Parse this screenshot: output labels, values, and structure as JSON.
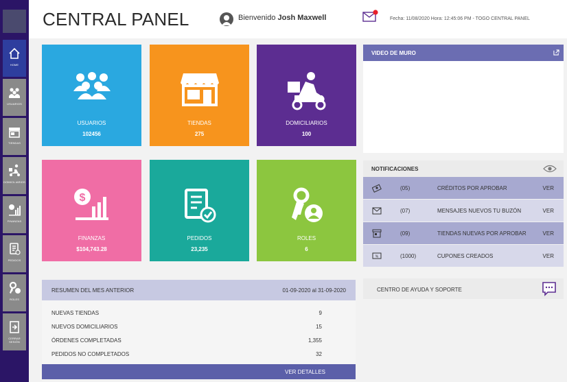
{
  "app": {
    "title": "CENTRAL PANEL",
    "welcome_text": "Bienvenido",
    "user_name": "Josh Maxwell",
    "date_info": "Fecha: 11/08/2020 Hora: 12:45:06 PM  - TOGO CENTRAL PANEL"
  },
  "sidebar": {
    "items": [
      {
        "label": "HOME",
        "icon": "home-icon"
      },
      {
        "label": "USUARIOS",
        "icon": "users-icon"
      },
      {
        "label": "TIENDAS",
        "icon": "store-icon"
      },
      {
        "label": "DOMICILIARIOS",
        "icon": "delivery-icon"
      },
      {
        "label": "FINANZAS",
        "icon": "finance-icon"
      },
      {
        "label": "PEDIDOS",
        "icon": "orders-icon"
      },
      {
        "label": "ROLES",
        "icon": "roles-icon"
      },
      {
        "label": "CERRAR SESIÓN",
        "icon": "logout-icon"
      }
    ]
  },
  "tiles": [
    {
      "label": "USUARIOS",
      "value": "102456",
      "color": "#2aa8e0",
      "icon": "users-icon"
    },
    {
      "label": "TIENDAS",
      "value": "275",
      "color": "#f7941d",
      "icon": "store-icon"
    },
    {
      "label": "DOMICILIARIOS",
      "value": "100",
      "color": "#5c2d91",
      "icon": "delivery-icon"
    },
    {
      "label": "FINANZAS",
      "value": "$104,743.28",
      "color": "#f06da5",
      "icon": "finance-icon"
    },
    {
      "label": "PEDIDOS",
      "value": "23,235",
      "color": "#1aa99b",
      "icon": "orders-icon"
    },
    {
      "label": "ROLES",
      "value": "6",
      "color": "#8cc63f",
      "icon": "roles-icon"
    }
  ],
  "summary": {
    "title": "RESUMEN DEL MES ANTERIOR",
    "range": "01-09-2020 al 31-09-2020",
    "rows": [
      {
        "label": "NUEVAS TIENDAS",
        "value": "9"
      },
      {
        "label": "NUEVOS DOMICILIARIOS",
        "value": "15"
      },
      {
        "label": "ÓRDENES COMPLETADAS",
        "value": "1,355"
      },
      {
        "label": "PEDIDOS NO COMPLETADOS",
        "value": "32"
      }
    ],
    "button": "VER DETALLES"
  },
  "video": {
    "title": "VIDEO DE MURO"
  },
  "notifications": {
    "title": "NOTIFICACIONES",
    "rows": [
      {
        "count": "(05)",
        "text": "CRÉDITOS POR APROBAR",
        "action": "VER",
        "icon": "money-icon"
      },
      {
        "count": "(07)",
        "text": "MENSAJES NUEVOS TU  BUZÓN",
        "action": "VER",
        "icon": "mail-icon"
      },
      {
        "count": "(09)",
        "text": "TIENDAS NUEVAS POR APROBAR",
        "action": "VER",
        "icon": "store-icon"
      },
      {
        "count": "(1000)",
        "text": "CUPONES CREADOS",
        "action": "VER",
        "icon": "coupon-icon"
      }
    ]
  },
  "help": {
    "title": "CENTRO DE AYUDA Y SOPORTE"
  }
}
